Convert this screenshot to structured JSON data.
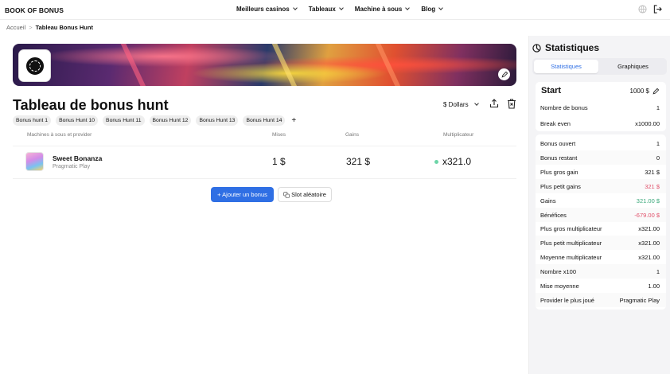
{
  "brand": "BOOK OF BONUS",
  "nav": {
    "menu": [
      "Meilleurs casinos",
      "Tableaux",
      "Machine à sous",
      "Blog"
    ]
  },
  "breadcrumb": {
    "home": "Accueil",
    "separator": ">",
    "current": "Tableau Bonus Hunt"
  },
  "page": {
    "title": "Tableau de bonus hunt",
    "currency": "$ Dollars"
  },
  "tabs": [
    "Bonus hunt 1",
    "Bonus Hunt 10",
    "Bonus Hunt 11",
    "Bonus Hunt 12",
    "Bonus Hunt 13",
    "Bonus Hunt 14"
  ],
  "tab_add": "+",
  "table": {
    "headers": {
      "slot": "Machines à sous et provider",
      "bet": "Mises",
      "gain": "Gains",
      "multiplier": "Multiplicateur"
    },
    "rows": [
      {
        "name": "Sweet Bonanza",
        "provider": "Pragmatic Play",
        "bet": "1 $",
        "gain": "321 $",
        "multiplier": "x321.0"
      }
    ]
  },
  "actions": {
    "add_bonus": "+ Ajouter un bonus",
    "random_slot": "Slot aléatoire"
  },
  "stats": {
    "title": "Statistiques",
    "tabs": [
      "Statistiques",
      "Graphiques"
    ],
    "start_label": "Start",
    "start_value": "1000 $",
    "group1": [
      {
        "label": "Nombre de bonus",
        "value": "1"
      },
      {
        "label": "Break even",
        "value": "x1000.00"
      }
    ],
    "group2": [
      {
        "label": "Bonus ouvert",
        "value": "1"
      },
      {
        "label": "Bonus restant",
        "value": "0"
      },
      {
        "label": "Plus gros gain",
        "value": "321 $"
      },
      {
        "label": "Plus petit gains",
        "value": "321 $"
      },
      {
        "label": "Gains",
        "value": "321.00 $"
      },
      {
        "label": "Bénéfices",
        "value": "-679.00 $"
      },
      {
        "label": "Plus gros multiplicateur",
        "value": "x321.00"
      },
      {
        "label": "Plus petit multiplicateur",
        "value": "x321.00"
      },
      {
        "label": "Moyenne multiplicateur",
        "value": "x321.00"
      },
      {
        "label": "Nombre x100",
        "value": "1"
      },
      {
        "label": "Mise moyenne",
        "value": "1.00"
      },
      {
        "label": "Provider le plus joué",
        "value": "Pragmatic Play"
      }
    ]
  },
  "colors": {
    "accent": "#2f6fe4",
    "positive": "#3aa87a",
    "negative": "#e0506a",
    "status_dot": "#6dd5a8"
  }
}
